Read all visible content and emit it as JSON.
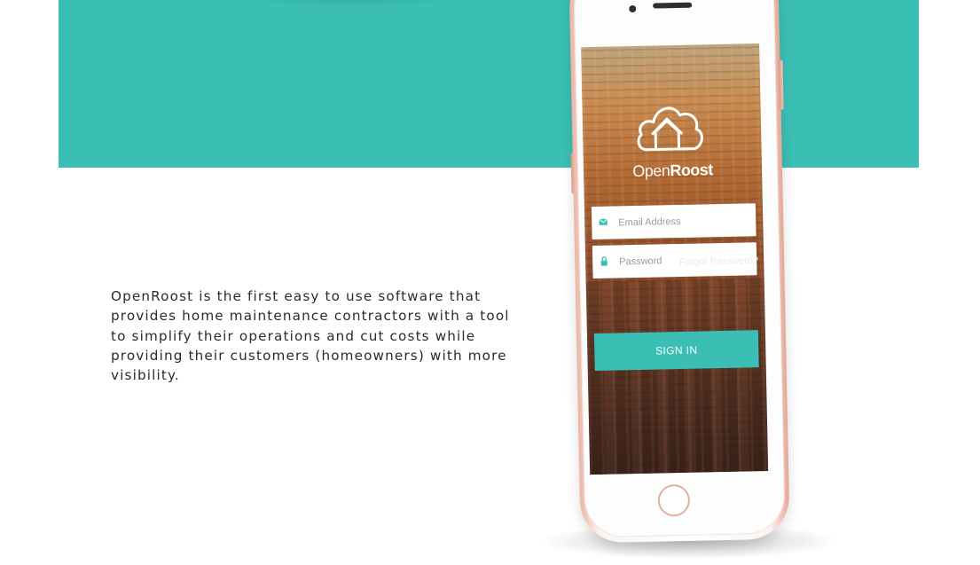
{
  "hero": {
    "description": "OpenRoost is the first easy to use software that provides home maintenance contractors with a tool to simplify their operations and cut costs while providing their customers (homeowners) with more visibility."
  },
  "app": {
    "brand_light": "Open",
    "brand_bold": "Roost",
    "logo_icon": "cloud-house-icon",
    "email": {
      "placeholder": "Email Address",
      "value": "",
      "icon": "envelope-icon"
    },
    "password": {
      "placeholder": "Password",
      "value": "",
      "icon": "lock-icon"
    },
    "forgot_password": "Forgot Password?",
    "sign_in": "SIGN IN"
  },
  "colors": {
    "accent": "#3bbfb5",
    "text": "#2b2b2b",
    "phone_rose_gold": "#e3a896"
  }
}
